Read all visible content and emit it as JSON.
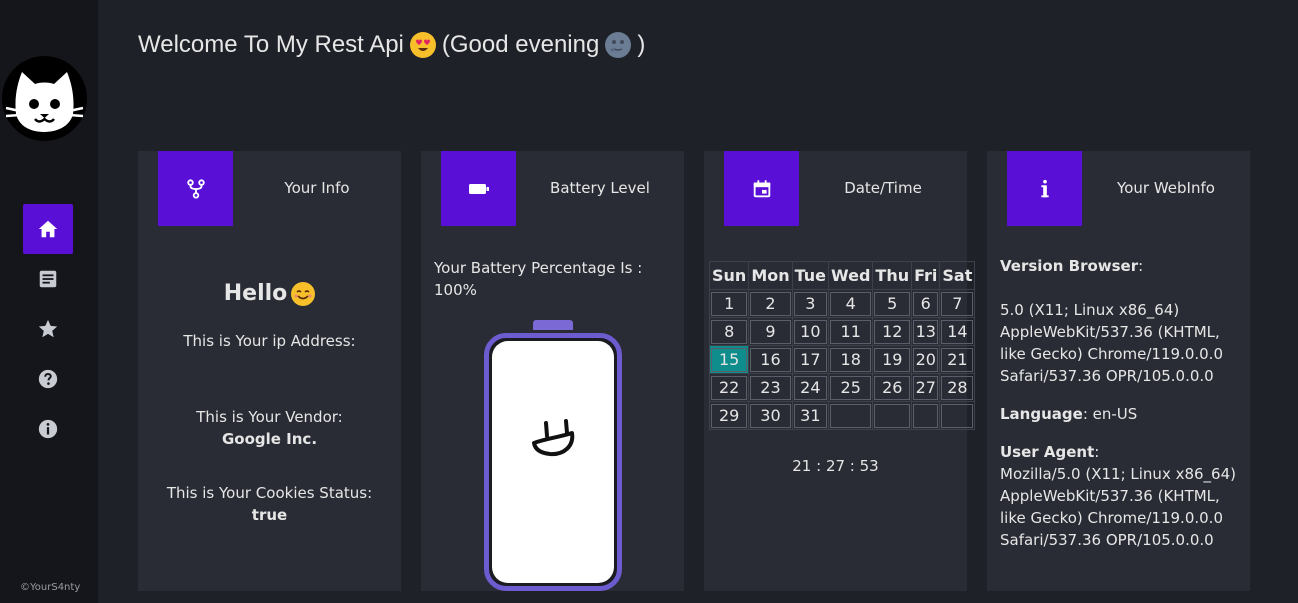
{
  "app": {
    "welcome_text": "Welcome To My Rest Api",
    "greeting": "(Good evening",
    "greeting_close": ")",
    "copyright": "©YourS4nty"
  },
  "sidebar": {
    "items": [
      {
        "name": "home",
        "icon": "home-icon",
        "active": true
      },
      {
        "name": "articles",
        "icon": "document-icon",
        "active": false
      },
      {
        "name": "favorites",
        "icon": "star-icon",
        "active": false
      },
      {
        "name": "help",
        "icon": "help-icon",
        "active": false
      },
      {
        "name": "about",
        "icon": "info-icon",
        "active": false
      }
    ]
  },
  "cards": {
    "info": {
      "title": "Your Info",
      "icon": "fork-icon",
      "hello": "Hello",
      "ip_label": "This is Your ip Address:",
      "vendor_label": "This is Your Vendor:",
      "vendor_value": "Google Inc.",
      "cookies_label": "This is Your Cookies Status:",
      "cookies_value": "true"
    },
    "battery": {
      "title": "Battery Level",
      "icon": "battery-icon",
      "text": "Your Battery Percentage Is : 100%",
      "level": 1.0
    },
    "datetime": {
      "title": "Date/Time",
      "icon": "calendar-icon",
      "weekdays": [
        "Sun",
        "Mon",
        "Tue",
        "Wed",
        "Thu",
        "Fri",
        "Sat"
      ],
      "weeks": [
        [
          "1",
          "2",
          "3",
          "4",
          "5",
          "6",
          "7"
        ],
        [
          "8",
          "9",
          "10",
          "11",
          "12",
          "13",
          "14"
        ],
        [
          "15",
          "16",
          "17",
          "18",
          "19",
          "20",
          "21"
        ],
        [
          "22",
          "23",
          "24",
          "25",
          "26",
          "27",
          "28"
        ],
        [
          "29",
          "30",
          "31",
          "",
          "",
          "",
          ""
        ]
      ],
      "today": "15",
      "time": "21 : 27 : 53"
    },
    "webinfo": {
      "title": "Your WebInfo",
      "icon": "info-letter-icon",
      "version_label": "Version Browser",
      "version_value": "5.0 (X11; Linux x86_64) AppleWebKit/537.36 (KHTML, like Gecko) Chrome/119.0.0.0 Safari/537.36 OPR/105.0.0.0",
      "language_label": "Language",
      "language_value": "en-US",
      "agent_label": "User Agent",
      "agent_value": "Mozilla/5.0 (X11; Linux x86_64) AppleWebKit/537.36 (KHTML, like Gecko) Chrome/119.0.0.0 Safari/537.36 OPR/105.0.0.0"
    }
  },
  "colors": {
    "accent": "#5a0fd6",
    "today": "#0f8c8c",
    "battery_frame": "#6c5ccf"
  }
}
